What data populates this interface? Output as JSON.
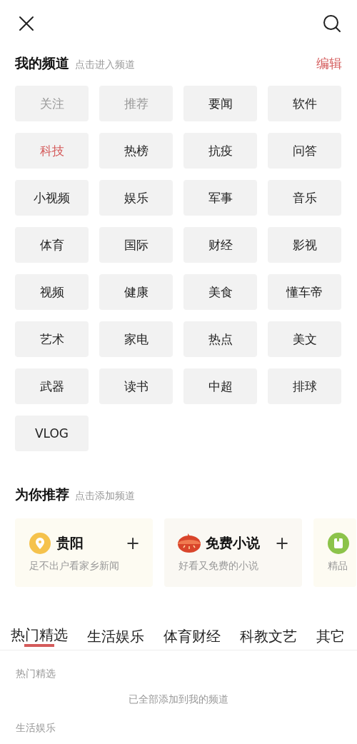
{
  "my_channels": {
    "title": "我的频道",
    "hint": "点击进入频道",
    "edit": "编辑",
    "items": [
      {
        "label": "关注",
        "disabled": true,
        "selected": false
      },
      {
        "label": "推荐",
        "disabled": true,
        "selected": false
      },
      {
        "label": "要闻",
        "disabled": false,
        "selected": false
      },
      {
        "label": "软件",
        "disabled": false,
        "selected": false
      },
      {
        "label": "科技",
        "disabled": false,
        "selected": true
      },
      {
        "label": "热榜",
        "disabled": false,
        "selected": false
      },
      {
        "label": "抗疫",
        "disabled": false,
        "selected": false
      },
      {
        "label": "问答",
        "disabled": false,
        "selected": false
      },
      {
        "label": "小视频",
        "disabled": false,
        "selected": false
      },
      {
        "label": "娱乐",
        "disabled": false,
        "selected": false
      },
      {
        "label": "军事",
        "disabled": false,
        "selected": false
      },
      {
        "label": "音乐",
        "disabled": false,
        "selected": false
      },
      {
        "label": "体育",
        "disabled": false,
        "selected": false
      },
      {
        "label": "国际",
        "disabled": false,
        "selected": false
      },
      {
        "label": "财经",
        "disabled": false,
        "selected": false
      },
      {
        "label": "影视",
        "disabled": false,
        "selected": false
      },
      {
        "label": "视频",
        "disabled": false,
        "selected": false
      },
      {
        "label": "健康",
        "disabled": false,
        "selected": false
      },
      {
        "label": "美食",
        "disabled": false,
        "selected": false
      },
      {
        "label": "懂车帝",
        "disabled": false,
        "selected": false
      },
      {
        "label": "艺术",
        "disabled": false,
        "selected": false
      },
      {
        "label": "家电",
        "disabled": false,
        "selected": false
      },
      {
        "label": "热点",
        "disabled": false,
        "selected": false
      },
      {
        "label": "美文",
        "disabled": false,
        "selected": false
      },
      {
        "label": "武器",
        "disabled": false,
        "selected": false
      },
      {
        "label": "读书",
        "disabled": false,
        "selected": false
      },
      {
        "label": "中超",
        "disabled": false,
        "selected": false
      },
      {
        "label": "排球",
        "disabled": false,
        "selected": false
      },
      {
        "label": "VLOG",
        "disabled": false,
        "selected": false
      }
    ]
  },
  "recommended": {
    "title": "为你推荐",
    "hint": "点击添加频道",
    "cards": [
      {
        "kind": "location",
        "title": "贵阳",
        "add": "+",
        "subtitle": "足不出户看家乡新闻"
      },
      {
        "kind": "novel",
        "title": "免费小说",
        "add": "+",
        "subtitle": "好看又免费的小说"
      },
      {
        "kind": "book",
        "subtitle": "精品"
      }
    ]
  },
  "category_tabs": [
    {
      "label": "热门精选",
      "selected": true
    },
    {
      "label": "生活娱乐",
      "selected": false
    },
    {
      "label": "体育财经",
      "selected": false
    },
    {
      "label": "科教文艺",
      "selected": false
    },
    {
      "label": "其它",
      "selected": false
    }
  ],
  "sections": [
    {
      "title": "热门精选",
      "note": "已全部添加到我的频道"
    },
    {
      "title": "生活娱乐"
    }
  ]
}
